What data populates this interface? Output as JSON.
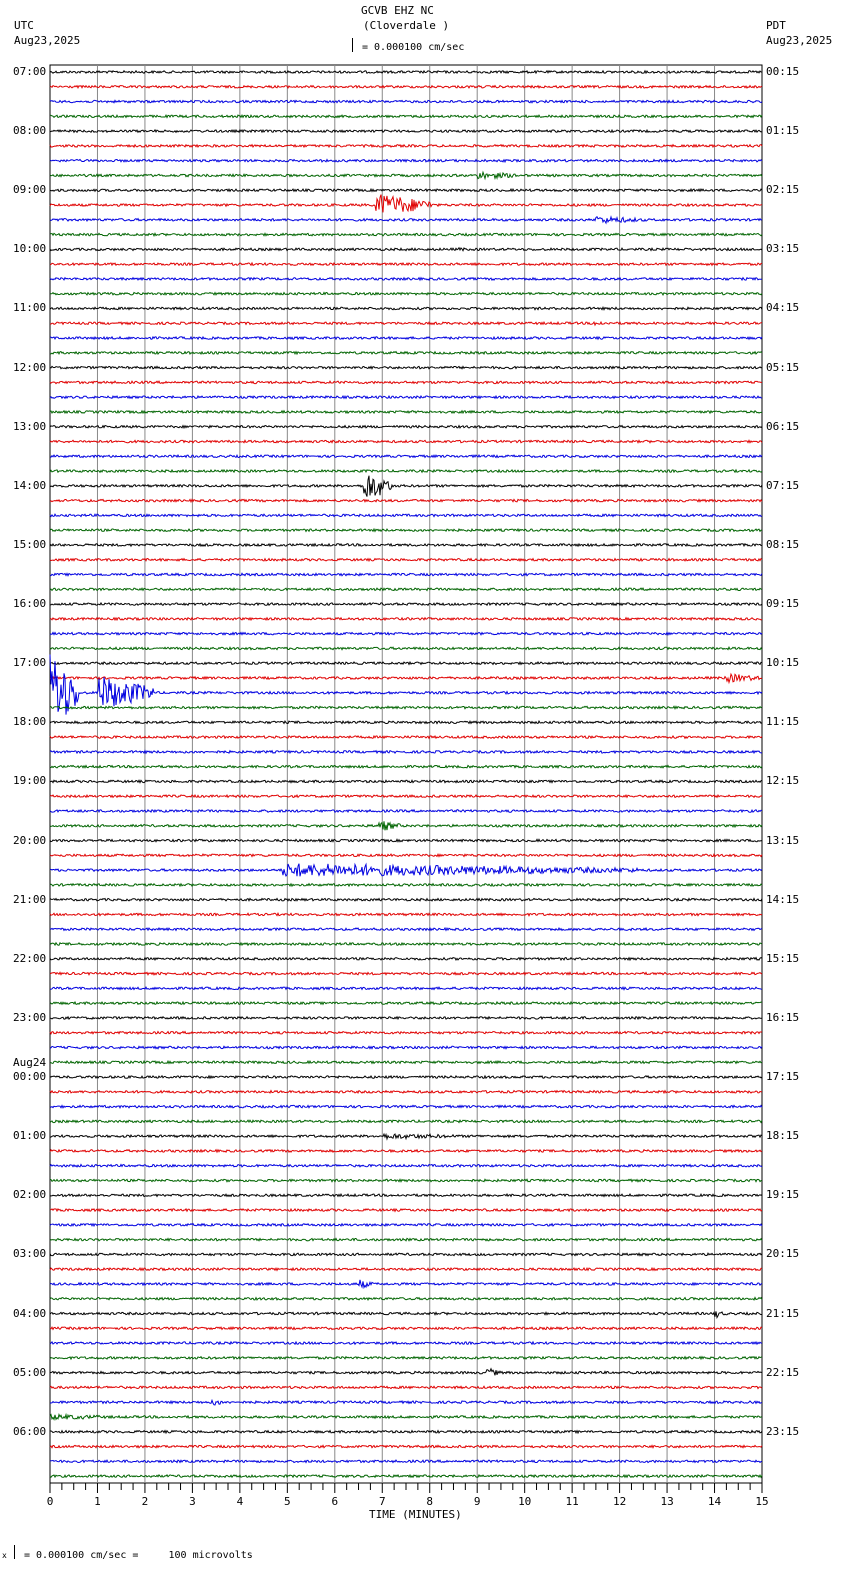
{
  "header": {
    "title": "GCVB EHZ NC",
    "subtitle": "(Cloverdale )",
    "scale_text": "= 0.000100 cm/sec",
    "left_tz": "UTC",
    "left_date": "Aug23,2025",
    "right_tz": "PDT",
    "right_date": "Aug23,2025"
  },
  "footer": {
    "prefix": "x",
    "scale_text": "= 0.000100 cm/sec =     100 microvolts"
  },
  "chart_data": {
    "type": "line",
    "title": "GCVB EHZ NC (Cloverdale )",
    "xlabel": "TIME (MINUTES)",
    "xlim": [
      0,
      15
    ],
    "x_ticks": [
      "0",
      "1",
      "2",
      "3",
      "4",
      "5",
      "6",
      "7",
      "8",
      "9",
      "10",
      "11",
      "12",
      "13",
      "14",
      "15"
    ],
    "trace_colors": [
      "#000000",
      "#e00000",
      "#0000e0",
      "#006400"
    ],
    "traces_per_hour": 4,
    "trace_count": 96,
    "left_labels": [
      "07:00",
      "08:00",
      "09:00",
      "10:00",
      "11:00",
      "12:00",
      "13:00",
      "14:00",
      "15:00",
      "16:00",
      "17:00",
      "18:00",
      "19:00",
      "20:00",
      "21:00",
      "22:00",
      "23:00",
      "00:00",
      "01:00",
      "02:00",
      "03:00",
      "04:00",
      "05:00",
      "06:00"
    ],
    "left_date_change": {
      "label": "Aug24",
      "before_index": 17
    },
    "right_labels": [
      "00:15",
      "01:15",
      "02:15",
      "03:15",
      "04:15",
      "05:15",
      "06:15",
      "07:15",
      "08:15",
      "09:15",
      "10:15",
      "11:15",
      "12:15",
      "13:15",
      "14:15",
      "15:15",
      "16:15",
      "17:15",
      "18:15",
      "19:15",
      "20:15",
      "21:15",
      "22:15",
      "23:15"
    ],
    "events": [
      {
        "trace": 7,
        "start_min": 9.0,
        "duration_min": 1.0,
        "amplitude": 4
      },
      {
        "trace": 9,
        "start_min": 6.85,
        "duration_min": 1.2,
        "amplitude": 12
      },
      {
        "trace": 10,
        "start_min": 11.5,
        "duration_min": 1.1,
        "amplitude": 4
      },
      {
        "trace": 12,
        "start_min": 8.6,
        "duration_min": 0.3,
        "amplitude": 2
      },
      {
        "trace": 17,
        "start_min": 11.4,
        "duration_min": 0.4,
        "amplitude": 3
      },
      {
        "trace": 28,
        "start_min": 6.6,
        "duration_min": 0.6,
        "amplitude": 16
      },
      {
        "trace": 41,
        "start_min": 14.2,
        "duration_min": 0.8,
        "amplitude": 5
      },
      {
        "trace": 42,
        "start_min": 0.0,
        "duration_min": 0.6,
        "amplitude": 40
      },
      {
        "trace": 42,
        "start_min": 1.0,
        "duration_min": 1.2,
        "amplitude": 18
      },
      {
        "trace": 51,
        "start_min": 6.9,
        "duration_min": 0.5,
        "amplitude": 6
      },
      {
        "trace": 54,
        "start_min": 4.9,
        "duration_min": 7.5,
        "amplitude": 7
      },
      {
        "trace": 72,
        "start_min": 7.0,
        "duration_min": 2.0,
        "amplitude": 3
      },
      {
        "trace": 82,
        "start_min": 6.5,
        "duration_min": 0.3,
        "amplitude": 5
      },
      {
        "trace": 84,
        "start_min": 14.0,
        "duration_min": 0.2,
        "amplitude": 5
      },
      {
        "trace": 88,
        "start_min": 9.2,
        "duration_min": 0.3,
        "amplitude": 5
      },
      {
        "trace": 90,
        "start_min": 3.4,
        "duration_min": 0.3,
        "amplitude": 4
      },
      {
        "trace": 91,
        "start_min": 0.0,
        "duration_min": 1.5,
        "amplitude": 3
      }
    ]
  }
}
